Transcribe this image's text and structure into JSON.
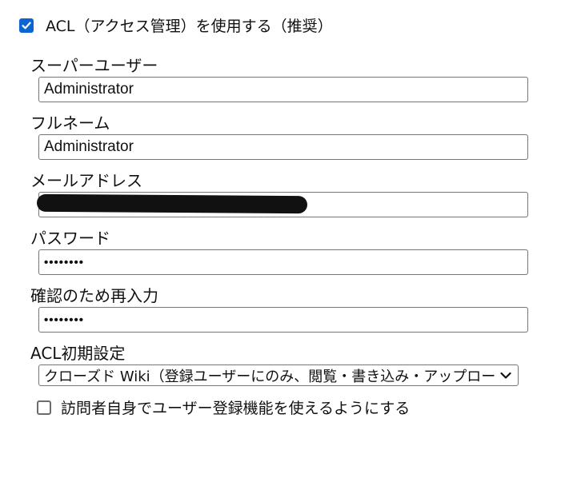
{
  "acl": {
    "checked": true,
    "label": "ACL（アクセス管理）を使用する（推奨）"
  },
  "fields": {
    "superuser": {
      "label": "スーパーユーザー",
      "value": "Administrator"
    },
    "fullname": {
      "label": "フルネーム",
      "value": "Administrator"
    },
    "email": {
      "label": "メールアドレス",
      "value": "",
      "redacted": true
    },
    "password": {
      "label": "パスワード",
      "value": "••••••••"
    },
    "confirm": {
      "label": "確認のため再入力",
      "value": "••••••••"
    }
  },
  "initial_policy": {
    "label": "ACL初期設定",
    "selected": "クローズド Wiki（登録ユーザーにのみ、閲覧・書き込み・アップロードを許可）"
  },
  "self_registration": {
    "checked": false,
    "label": "訪問者自身でユーザー登録機能を使えるようにする"
  },
  "colors": {
    "accent": "#0b64d1",
    "border": "#767676",
    "text": "#111111"
  },
  "icons": {
    "check": "check-icon",
    "dropdown": "chevron-down-icon"
  }
}
